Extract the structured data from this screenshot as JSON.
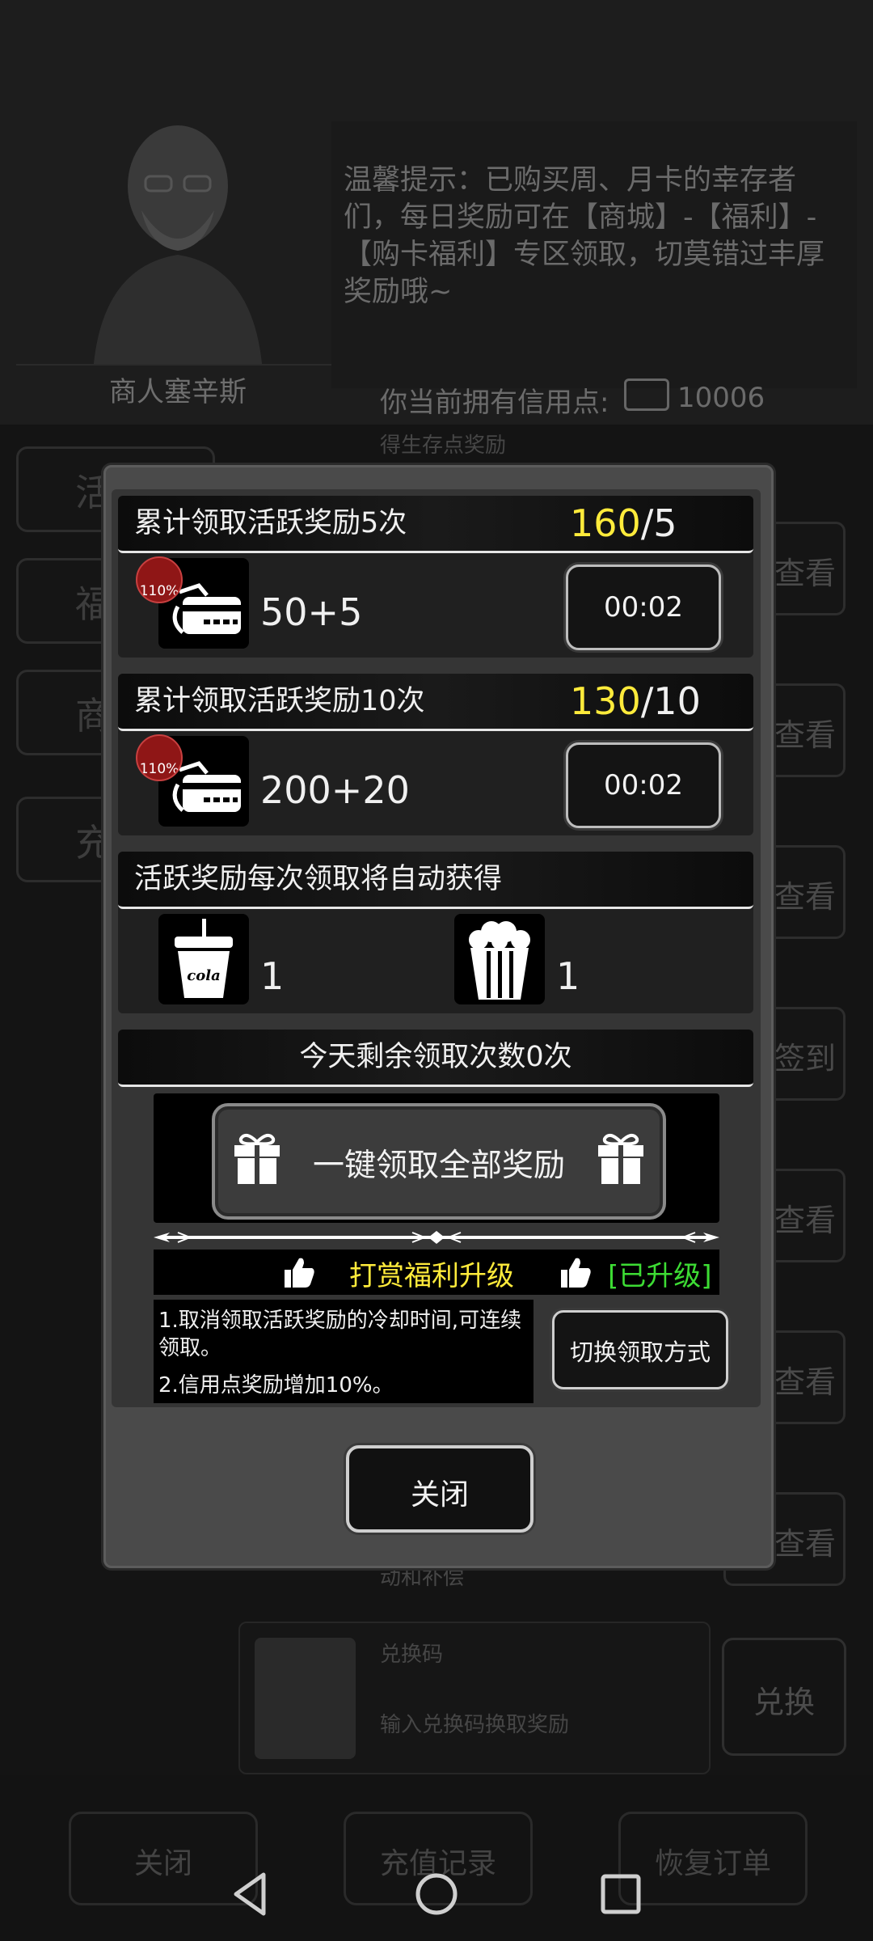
{
  "background": {
    "merchant_name": "商人塞辛斯",
    "tip_text": "温馨提示：已购买周、月卡的幸存者们，每日奖励可在【商城】-【福利】-【购卡福利】专区领取，切莫错过丰厚奖励哦~",
    "credit_label": "你当前拥有信用点:",
    "credit_value": "10006",
    "side_tabs": [
      "活",
      "福",
      "商",
      "充"
    ],
    "faint_line_1": "得生存点奖励",
    "view_label": "查看",
    "checkin_label": "签到",
    "faint_line_2": "动和补偿",
    "redeem": {
      "title": "兑换码",
      "placeholder": "输入兑换码换取奖励",
      "button": "兑换"
    },
    "bottom_buttons": [
      "关闭",
      "充值记录",
      "恢复订单"
    ]
  },
  "modal": {
    "reward1": {
      "title": "累计领取活跃奖励5次",
      "count_current": "160",
      "count_total": "/5",
      "badge": "110%",
      "amount": "50+5",
      "timer": "00:02"
    },
    "reward2": {
      "title": "累计领取活跃奖励10次",
      "count_current": "130",
      "count_total": "/10",
      "badge": "110%",
      "amount": "200+20",
      "timer": "00:02"
    },
    "auto_title": "活跃奖励每次领取将自动获得",
    "auto_items": [
      {
        "icon": "cola-icon",
        "label": "cola",
        "qty": "1"
      },
      {
        "icon": "popcorn-icon",
        "qty": "1"
      }
    ],
    "remaining": "今天剩余领取次数0次",
    "claim_all": "一键领取全部奖励",
    "upgrade_label": "打赏福利升级",
    "upgraded_label": "[已升级]",
    "notes": [
      "1.取消领取活跃奖励的冷却时间,可连续领取。",
      "2.信用点奖励增加10%。"
    ],
    "switch_button": "切换领取方式",
    "close_button": "关闭"
  },
  "colors": {
    "highlight_yellow": "#ffeb3b",
    "upgraded_green": "#3ddc34",
    "badge_red": "#8f1616"
  }
}
